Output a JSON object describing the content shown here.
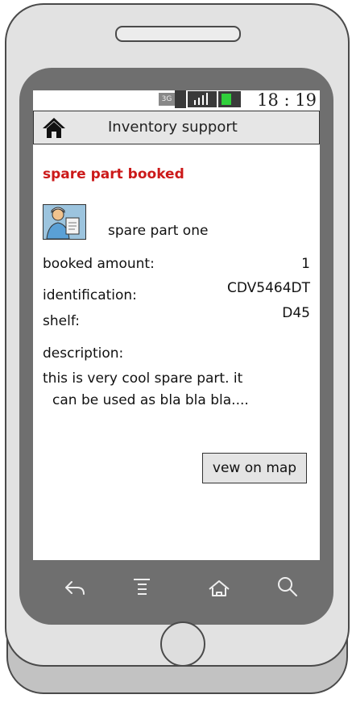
{
  "status_bar": {
    "network": "3G",
    "time": "18 : 19"
  },
  "action_bar": {
    "title": "Inventory support"
  },
  "content": {
    "header": "spare part booked",
    "part_name": "spare part one",
    "rows": [
      {
        "label": "booked amount:",
        "value": "1"
      },
      {
        "label": "identification:",
        "value": "CDV5464DT"
      },
      {
        "label": "shelf:",
        "value": "D45"
      }
    ],
    "description_label": "description:",
    "description_line1": "this is very cool spare part. it",
    "description_line2": "can be used as bla bla bla....",
    "map_button": "vew on map"
  },
  "colors": {
    "header_red": "#cc1a1a",
    "battery_green": "#2fcf3a",
    "bezel": "#6f6f6f"
  },
  "icons": {
    "home": "home-icon",
    "back": "back-icon",
    "menu": "menu-icon",
    "nav_home": "nav-home-icon",
    "search": "search-icon"
  }
}
